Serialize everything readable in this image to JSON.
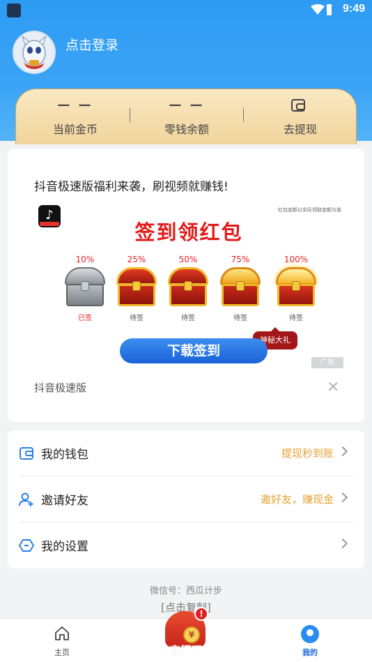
{
  "status_bar": {
    "time": "9:49"
  },
  "header": {
    "login_text": "点击登录"
  },
  "gold_card": {
    "coins_value": "— —",
    "coins_label": "当前金币",
    "balance_value": "— —",
    "balance_label": "零钱余额",
    "withdraw_label": "去提现"
  },
  "ad": {
    "headline": "抖音极速版福利来袭，刷视频就赚钱!",
    "small_note": "红包金额以实际领取金额为准",
    "title": "签到领红包",
    "chests": [
      {
        "pct": "10%",
        "label": "已签"
      },
      {
        "pct": "25%",
        "label": "待签"
      },
      {
        "pct": "50%",
        "label": "待签"
      },
      {
        "pct": "75%",
        "label": "待签"
      },
      {
        "pct": "100%",
        "label": "待签"
      }
    ],
    "gift_badge": "神秘大礼",
    "button": "下载签到",
    "ad_mark": "广告",
    "source": "抖音极速版",
    "close": "✕"
  },
  "menu": {
    "items": [
      {
        "label": "我的钱包",
        "hint": "提现秒到账"
      },
      {
        "label": "邀请好友",
        "hint": "邀好友，赚现金"
      },
      {
        "label": "我的设置",
        "hint": ""
      }
    ]
  },
  "footer": {
    "wechat": "微信号：西瓜计步",
    "copy": "[点击复制]"
  },
  "tabbar": {
    "home": "主页",
    "center": "来提现",
    "center_coin": "¥",
    "center_alert": "!",
    "me": "我的"
  },
  "colors": {
    "header_blue": "#2e9bf3",
    "accent_gold": "#e4a233",
    "ad_red": "#e21a1a",
    "button_blue": "#1a63d8"
  }
}
